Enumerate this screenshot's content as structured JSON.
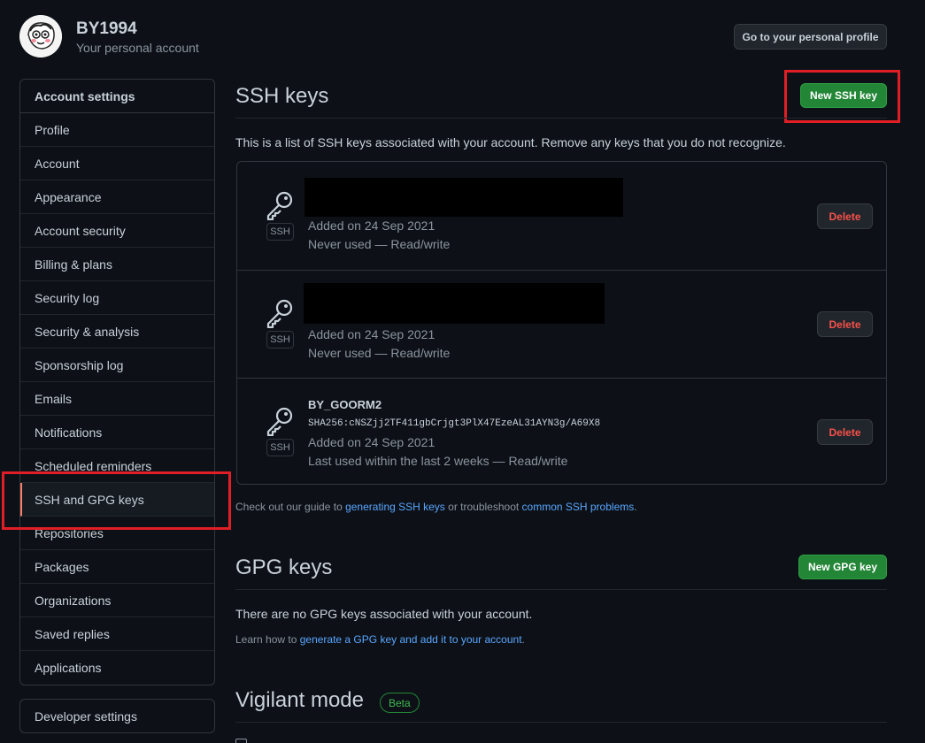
{
  "account": {
    "username": "BY1994",
    "subtitle": "Your personal account",
    "profile_button": "Go to your personal profile"
  },
  "sidebar": {
    "header": "Account settings",
    "items": [
      {
        "label": "Profile"
      },
      {
        "label": "Account"
      },
      {
        "label": "Appearance"
      },
      {
        "label": "Account security"
      },
      {
        "label": "Billing & plans"
      },
      {
        "label": "Security log"
      },
      {
        "label": "Security & analysis"
      },
      {
        "label": "Sponsorship log"
      },
      {
        "label": "Emails"
      },
      {
        "label": "Notifications"
      },
      {
        "label": "Scheduled reminders"
      },
      {
        "label": "SSH and GPG keys",
        "active": true
      },
      {
        "label": "Repositories"
      },
      {
        "label": "Packages"
      },
      {
        "label": "Organizations"
      },
      {
        "label": "Saved replies"
      },
      {
        "label": "Applications"
      }
    ],
    "developer_settings": "Developer settings"
  },
  "ssh": {
    "title": "SSH keys",
    "new_button": "New SSH key",
    "description": "This is a list of SSH keys associated with your account. Remove any keys that you do not recognize.",
    "keys": [
      {
        "title": "",
        "fingerprint": "",
        "badge": "SSH",
        "added": "Added on 24 Sep 2021",
        "usage": "Never used — Read/write",
        "delete_label": "Delete"
      },
      {
        "title": "",
        "fingerprint": "",
        "badge": "SSH",
        "added": "Added on 24 Sep 2021",
        "usage": "Never used — Read/write",
        "delete_label": "Delete"
      },
      {
        "title": "BY_GOORM2",
        "fingerprint": "SHA256:cNSZjj2TF411gbCrjgt3PlX47EzeAL31AYN3g/A69X8",
        "badge": "SSH",
        "added": "Added on 24 Sep 2021",
        "usage": "Last used within the last 2 weeks — Read/write",
        "delete_label": "Delete"
      }
    ],
    "guide": {
      "prefix": "Check out our guide to ",
      "link1": "generating SSH keys",
      "middle": " or troubleshoot ",
      "link2": "common SSH problems",
      "suffix": "."
    }
  },
  "gpg": {
    "title": "GPG keys",
    "new_button": "New GPG key",
    "empty": "There are no GPG keys associated with your account.",
    "learn_prefix": "Learn how to ",
    "learn_link": "generate a GPG key and add it to your account",
    "learn_suffix": "."
  },
  "vigilant": {
    "title": "Vigilant mode",
    "badge": "Beta"
  },
  "colors": {
    "background": "#0d1117",
    "green_button": "#238636",
    "link": "#58a6ff",
    "danger": "#f85149",
    "highlight": "#e01e25",
    "active_indicator": "#f78166"
  }
}
